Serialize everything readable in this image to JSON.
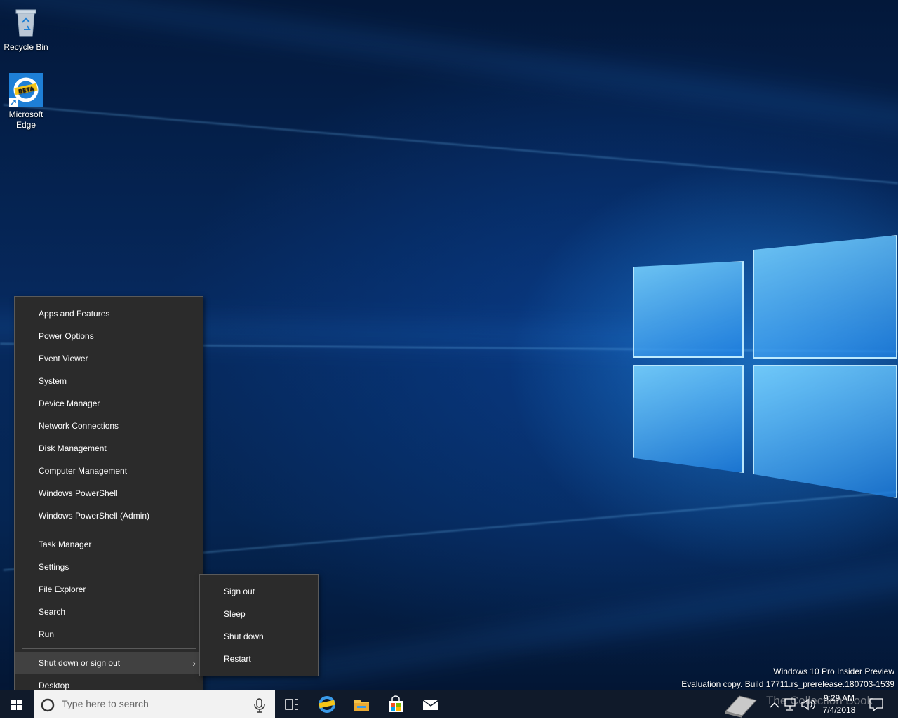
{
  "desktop": {
    "icons": [
      {
        "label": "Recycle Bin",
        "icon": "recycle-bin-icon"
      },
      {
        "label": "Microsoft Edge",
        "icon": "edge-beta-icon",
        "badge": "BETA"
      }
    ],
    "watermark": {
      "line1": "Windows 10 Pro Insider Preview",
      "line2": "Evaluation copy. Build 17711.rs_prerelease.180703-1539"
    }
  },
  "context_menu": {
    "group1": [
      "Apps and Features",
      "Power Options",
      "Event Viewer",
      "System",
      "Device Manager",
      "Network Connections",
      "Disk Management",
      "Computer Management",
      "Windows PowerShell",
      "Windows PowerShell (Admin)"
    ],
    "group2": [
      "Task Manager",
      "Settings",
      "File Explorer",
      "Search",
      "Run"
    ],
    "group3": [
      "Shut down or sign out",
      "Desktop"
    ],
    "highlighted": "Shut down or sign out"
  },
  "submenu": {
    "items": [
      "Sign out",
      "Sleep",
      "Shut down",
      "Restart"
    ]
  },
  "taskbar": {
    "search_placeholder": "Type here to search",
    "pinned": [
      "task-view-icon",
      "edge-beta-icon",
      "file-explorer-icon",
      "store-icon",
      "mail-icon"
    ],
    "overlay_text": "The Collection Book",
    "time": "9:29 AM",
    "date": "7/4/2018"
  },
  "colors": {
    "menu_bg": "#2b2b2b",
    "menu_highlight": "#414141",
    "taskbar_bg": "#101a2a",
    "accent": "#0078d7"
  }
}
